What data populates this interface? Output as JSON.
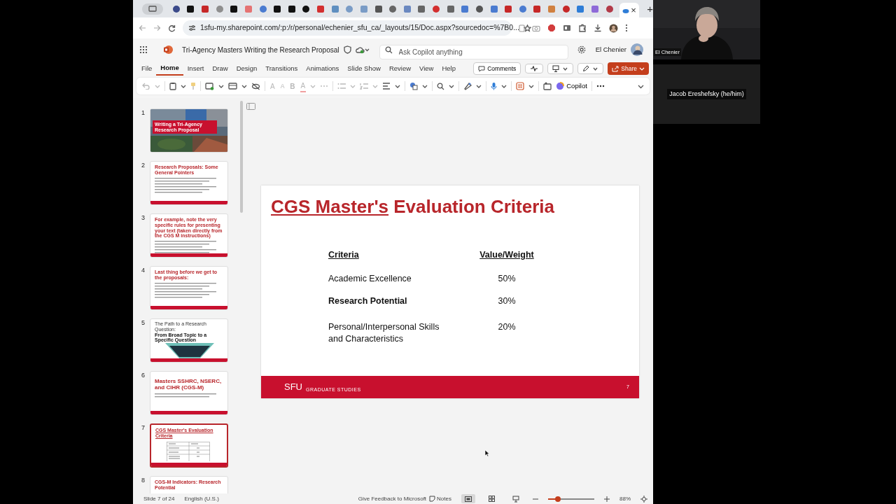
{
  "browser": {
    "address": "1sfu-my.sharepoint.com/:p:/r/personal/echenier_sfu_ca/_layouts/15/Doc.aspx?sourcedoc=%7B0...",
    "close_tab": "×",
    "new_tab": "+"
  },
  "app": {
    "title": "Tri-Agency Masters Writing the Research Proposal",
    "search": {
      "placeholder": "Ask Copilot anything"
    },
    "user": "El Chenier"
  },
  "ribbon_tabs": [
    {
      "label": "File",
      "selected": false
    },
    {
      "label": "Home",
      "selected": true
    },
    {
      "label": "Insert",
      "selected": false
    },
    {
      "label": "Draw",
      "selected": false
    },
    {
      "label": "Design",
      "selected": false
    },
    {
      "label": "Transitions",
      "selected": false
    },
    {
      "label": "Animations",
      "selected": false
    },
    {
      "label": "Slide Show",
      "selected": false
    },
    {
      "label": "Review",
      "selected": false
    },
    {
      "label": "View",
      "selected": false
    },
    {
      "label": "Help",
      "selected": false
    }
  ],
  "ribbon_buttons": {
    "comments": "Comments",
    "share": "Share"
  },
  "toolbar": {
    "text_buttons": [
      {
        "label": "A",
        "kind": "grow",
        "disabled": true
      },
      {
        "label": "A",
        "kind": "shrink",
        "disabled": true
      },
      {
        "label": "B",
        "kind": "bold",
        "disabled": true
      },
      {
        "label": "A",
        "kind": "color",
        "disabled": true
      }
    ],
    "copilot": "Copilot"
  },
  "thumbnails": [
    {
      "number": "1",
      "title": "Writing a Tri-Agency Research Proposal",
      "selected": false
    },
    {
      "number": "2",
      "kind": "text",
      "title": "Research Proposals: Some General Pointers",
      "selected": false
    },
    {
      "number": "3",
      "kind": "text",
      "title": "For example, note the very specific rules for presenting your text (taken directly from the CGS M instructions)",
      "selected": false
    },
    {
      "number": "4",
      "kind": "text",
      "title": "Last thing before we get to the proposals:",
      "selected": false
    },
    {
      "number": "5",
      "kind": "pyramid",
      "subtitle": "The Path to a Research Question:",
      "title": "From Broad Topic to a Specific Question",
      "selected": false
    },
    {
      "number": "6",
      "kind": "big-title",
      "title": "Masters SSHRC, NSERC, and CIHR (CGS-M)",
      "selected": false
    },
    {
      "number": "7",
      "kind": "table",
      "title": "CGS Master's Evaluation Criteria",
      "selected": true
    },
    {
      "number": "8",
      "kind": "text",
      "title": "CGS-M Indicators: Research Potential",
      "selected": false
    }
  ],
  "slide": {
    "title": [
      {
        "text": "CGS Master's",
        "underlined": true
      },
      {
        "text": "Evaluation Criteria",
        "underlined": false
      }
    ],
    "columns": [
      "Criteria",
      "Value/Weight"
    ],
    "rows": [
      {
        "criterion": "Academic Excellence",
        "weight": "50%",
        "bold": false
      },
      {
        "criterion": "Research Potential",
        "weight": "30%",
        "bold": true
      },
      {
        "criterion": "Personal/Interpersonal Skills and Characteristics",
        "weight": "20%",
        "bold": false
      }
    ],
    "footer": {
      "logo": "SFU",
      "unit": "GRADUATE STUDIES",
      "page": "7"
    }
  },
  "status_bar": {
    "slide": "Slide 7 of 24",
    "language": "English (U.S.)",
    "feedback": "Give Feedback to Microsoft",
    "notes": "Notes",
    "zoom": {
      "level": 0.21
    },
    "zoom_text": "88%"
  },
  "video": [
    {
      "name": "El Chenier",
      "kind": "camera"
    },
    {
      "name": "Jacob Ereshefsky (he/him)",
      "kind": "name-only"
    }
  ]
}
